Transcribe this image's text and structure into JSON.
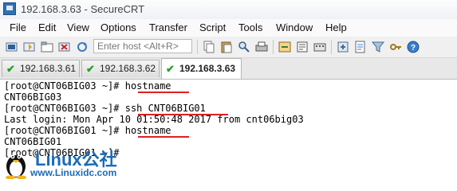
{
  "window": {
    "title": "192.168.3.63 - SecureCRT"
  },
  "menu": [
    "File",
    "Edit",
    "View",
    "Options",
    "Transfer",
    "Script",
    "Tools",
    "Window",
    "Help"
  ],
  "toolbar": {
    "host_placeholder": "Enter host <Alt+R>",
    "icons_left": [
      "connect-icon",
      "quick-connect-icon",
      "tab-icon",
      "disconnect-icon",
      "reconnect-icon"
    ],
    "icons_right": [
      "copy-icon",
      "paste-icon",
      "find-icon",
      "print-icon",
      "sftp-icon",
      "options-icon",
      "keymap-icon",
      "settings-icon",
      "help-icon"
    ]
  },
  "tabs": [
    {
      "label": "192.168.3.61",
      "active": false
    },
    {
      "label": "192.168.3.62",
      "active": false
    },
    {
      "label": "192.168.3.63",
      "active": true
    }
  ],
  "terminal": {
    "lines": [
      "[root@CNT06BIG03 ~]# hostname",
      "CNT06BIG03",
      "[root@CNT06BIG03 ~]# ssh CNT06BIG01",
      "Last login: Mon Apr 10 01:50:48 2017 from cnt06big03",
      "[root@CNT06BIG01 ~]# hostname",
      "CNT06BIG01",
      "[root@CNT06BIG01 ~]# "
    ]
  },
  "watermark": {
    "brand": "Linux公社",
    "url": "www.Linuxidc.com"
  },
  "colors": {
    "check": "#27a028",
    "underline": "#e02020",
    "watermark": "#1b6bb5"
  }
}
